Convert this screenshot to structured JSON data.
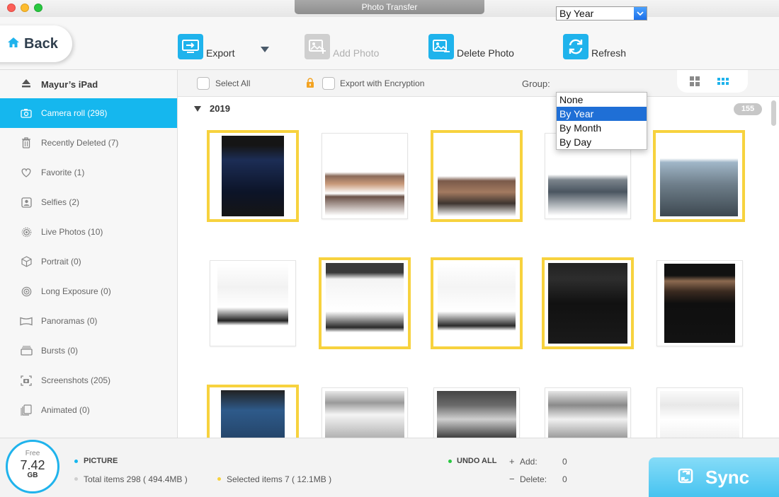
{
  "window": {
    "title": "Photo Transfer"
  },
  "toolbar": {
    "back_label": "Back",
    "export_label": "Export",
    "add_photo_label": "Add Photo",
    "delete_photo_label": "Delete Photo",
    "refresh_label": "Refresh"
  },
  "sidebar": {
    "device_name": "Mayur’s iPad",
    "items": [
      {
        "label": "Camera roll (298)",
        "icon": "camera-icon"
      },
      {
        "label": "Recently Deleted (7)",
        "icon": "trash-icon"
      },
      {
        "label": "Favorite (1)",
        "icon": "heart-icon"
      },
      {
        "label": "Selfies (2)",
        "icon": "selfie-icon"
      },
      {
        "label": "Live Photos (10)",
        "icon": "live-photo-icon"
      },
      {
        "label": "Portrait (0)",
        "icon": "cube-icon"
      },
      {
        "label": "Long Exposure (0)",
        "icon": "long-exposure-icon"
      },
      {
        "label": "Panoramas (0)",
        "icon": "panorama-icon"
      },
      {
        "label": "Bursts (0)",
        "icon": "bursts-icon"
      },
      {
        "label": "Screenshots (205)",
        "icon": "screenshot-icon"
      },
      {
        "label": "Animated (0)",
        "icon": "animated-icon"
      }
    ]
  },
  "filters": {
    "select_all_label": "Select All",
    "encryption_label": "Export with Encryption",
    "group_label": "Group:",
    "group_value": "By Year",
    "group_options": [
      "None",
      "By Year",
      "By Month",
      "By Day"
    ]
  },
  "gallery": {
    "year": "2019",
    "count": "155"
  },
  "footer": {
    "storage_free_label": "Free",
    "storage_value": "7.42",
    "storage_unit": "GB",
    "picture_label": "PICTURE",
    "total_items": "Total items 298 ( 494.4MB )",
    "selected_items": "Selected items 7 ( 12.1MB )",
    "undo_all_label": "UNDO ALL",
    "add_label": "Add:",
    "add_count": "0",
    "delete_label": "Delete:",
    "delete_count": "0",
    "sync_label": "Sync"
  },
  "colors": {
    "accent": "#15b7ee",
    "selection_border": "#f7d23e",
    "dropdown_highlight": "#1f6fd6"
  }
}
